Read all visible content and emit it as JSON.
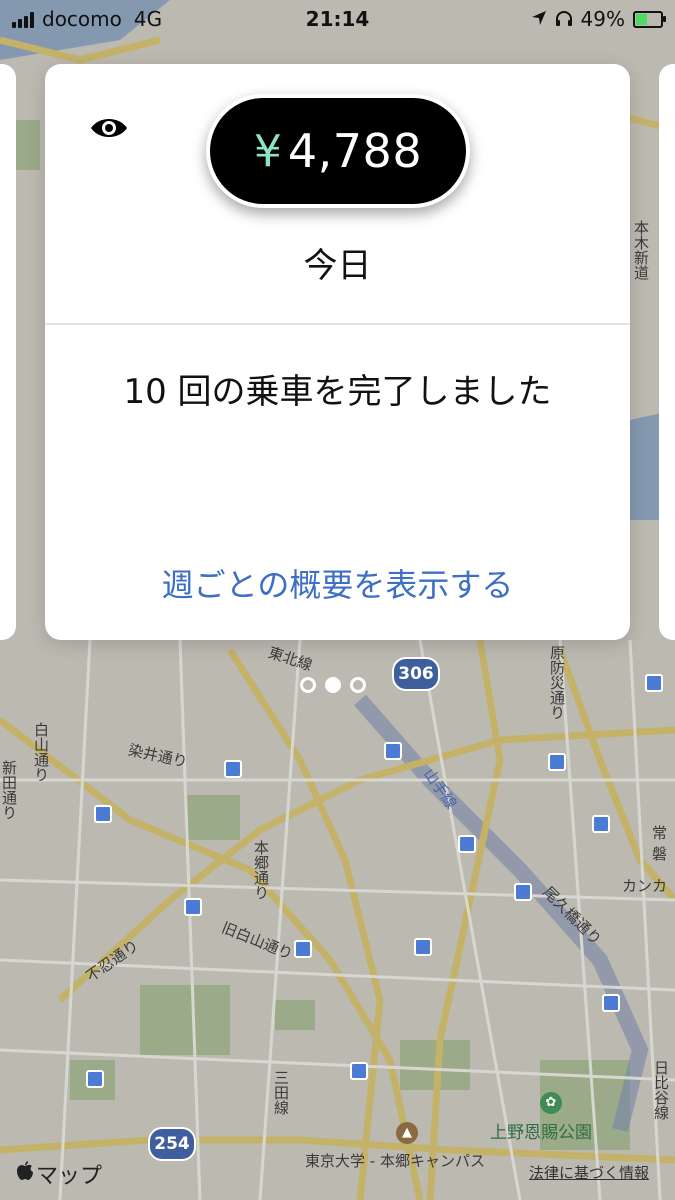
{
  "status_bar": {
    "carrier": "docomo",
    "network": "4G",
    "time": "21:14",
    "battery_percent": "49%"
  },
  "card": {
    "currency": "¥",
    "amount": "4,788",
    "period": "今日",
    "trips_text": "10 回の乗車を完了しました",
    "weekly_summary_link": "週ごとの概要を表示する"
  },
  "pager": {
    "page_count": 3,
    "active_index": 1
  },
  "map": {
    "labels": {
      "hakusan": "白山通り",
      "somei": "染井通り",
      "hongo": "本郷通り",
      "kyuhakusan": "旧白山通り",
      "shinobazu": "不忍通り",
      "mita": "三田線",
      "oku": "尾久橋通り",
      "harakata": "原防災通り",
      "ueno_park": "上野恩賜公園",
      "todai": "東京大学 - 本郷キャンパス",
      "motoki": "本木新道",
      "tohoku": "東北線",
      "yamanote": "山手線",
      "hibiya": "日比谷線",
      "kanka": "カンカ",
      "joban": "常磐",
      "shinden": "新田通り"
    },
    "route_306": "306",
    "route_254": "254"
  },
  "footer": {
    "maps_brand": "マップ",
    "legal_link": "法律に基づく情報"
  },
  "colors": {
    "link": "#3d6fc4",
    "currency": "#8fe3c4",
    "pill": "#000000"
  }
}
